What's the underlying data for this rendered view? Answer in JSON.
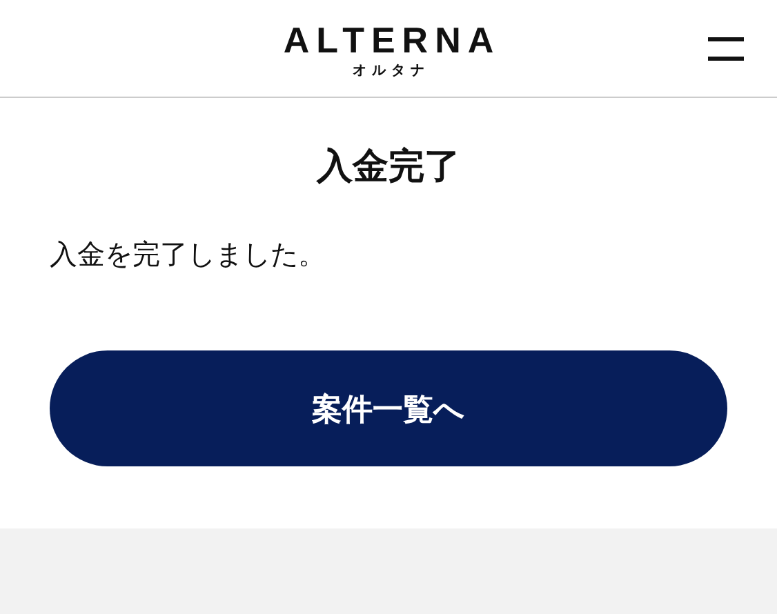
{
  "header": {
    "logo": "ALTERNA",
    "logo_sub": "オルタナ"
  },
  "page": {
    "title": "入金完了",
    "message": "入金を完了しました。",
    "button": "案件一覧へ"
  }
}
